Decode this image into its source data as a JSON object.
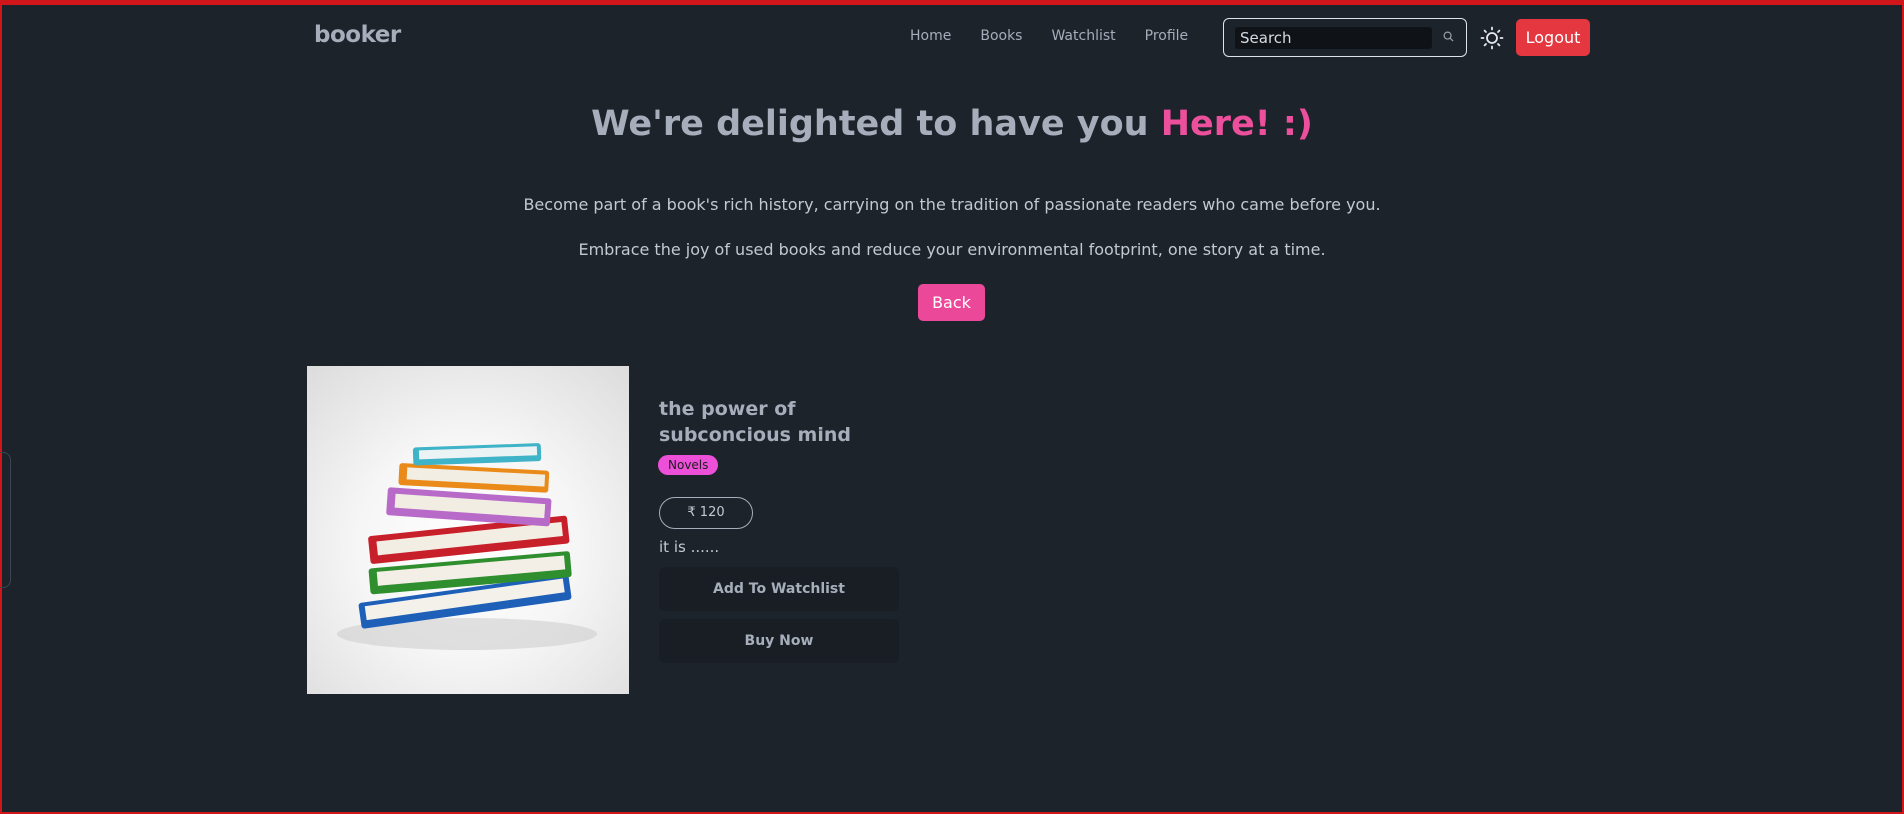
{
  "header": {
    "brand": "booker",
    "nav": [
      "Home",
      "Books",
      "Watchlist",
      "Profile"
    ],
    "search_value": "Search",
    "logout_label": "Logout"
  },
  "hero": {
    "title_main": "We're delighted to have you ",
    "title_highlight": "Here! :)",
    "paragraph1": "Become part of a book's rich history, carrying on the tradition of passionate readers who came before you.",
    "paragraph2": "Embrace the joy of used books and reduce your environmental footprint, one story at a time.",
    "back_label": "Back"
  },
  "book": {
    "title": "the power of subconcious mind",
    "category": "Novels",
    "price": "₹ 120",
    "description": "it is ......",
    "add_watchlist_label": "Add To Watchlist",
    "buy_label": "Buy Now",
    "image_icon": "stacked-books-image"
  },
  "colors": {
    "background": "#1d232a",
    "accent_pink": "#ec4899",
    "logout_red": "#e5373f",
    "badge": "#ec4fd8",
    "frame_border": "#d0161b"
  }
}
